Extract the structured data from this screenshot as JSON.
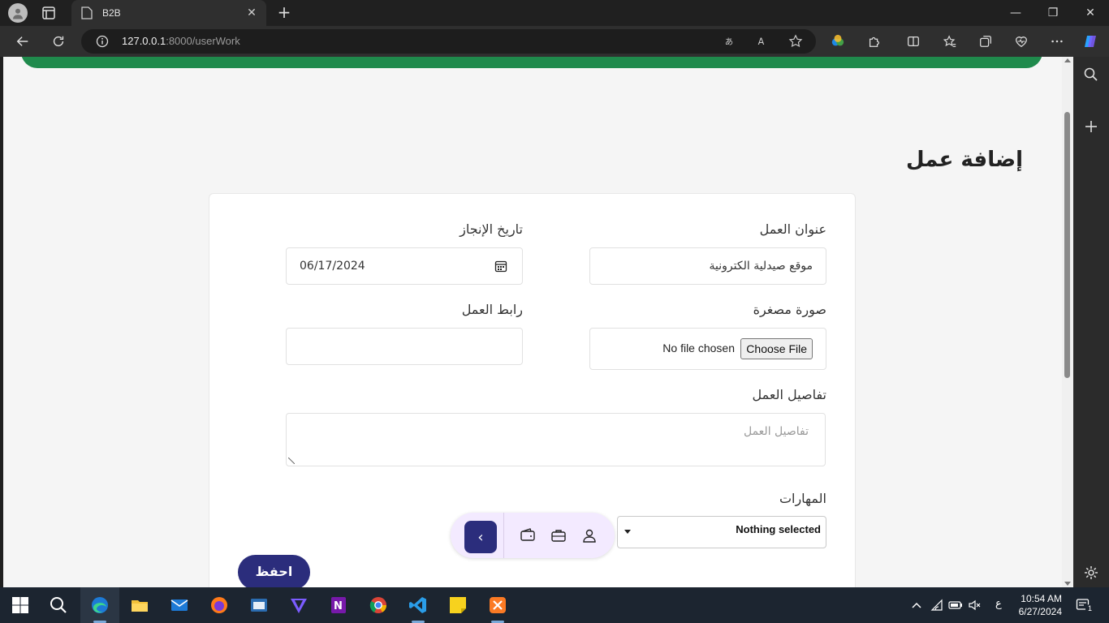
{
  "browser": {
    "tab_title": "B2B",
    "url_host": "127.0.0.1",
    "url_rest": ":8000/userWork",
    "new_tab": "+",
    "close": "✕",
    "minimize": "—",
    "restore": "❐",
    "win_close": "✕"
  },
  "page": {
    "title": "إضافة عمل",
    "form": {
      "work_title_label": "عنوان العمل",
      "work_title_value": "موقع صيدلية الكترونية",
      "date_label": "تاريخ الإنجاز",
      "date_value": "06/17/2024",
      "thumbnail_label": "صورة مصغرة",
      "choose_file": "Choose File",
      "no_file": "No file chosen",
      "link_label": "رابط العمل",
      "link_value": "",
      "details_label": "تفاصيل العمل",
      "details_placeholder": "تفاصيل العمل",
      "skills_label": "المهارات",
      "skills_value": "Nothing selected",
      "save_button": "احفظ"
    }
  },
  "floating_nav": {
    "back_glyph": "‹"
  },
  "taskbar": {
    "time": "10:54 AM",
    "date": "6/27/2024",
    "lang": "ع",
    "notification_count": "1"
  },
  "colors": {
    "accent_green": "#1f8a4c",
    "primary": "#2b2d7c",
    "nav_bg": "#f3eaff"
  }
}
